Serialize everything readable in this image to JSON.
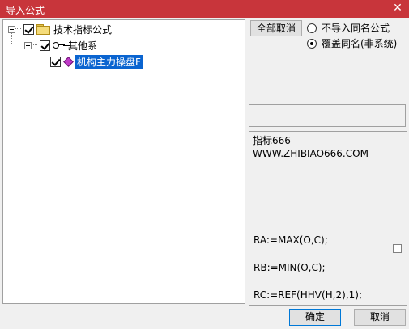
{
  "window": {
    "title": "导入公式",
    "close_glyph": "✕"
  },
  "tree": {
    "root": {
      "label": "技术指标公式",
      "checked": true
    },
    "group": {
      "label": "其他系",
      "checked": true
    },
    "item": {
      "label": "机构主力操盘F",
      "checked": true,
      "selected": true
    }
  },
  "options": {
    "deselect_all_label": "全部取消",
    "radio_skip_label": "不导入同名公式",
    "radio_overwrite_label": "覆盖同名(非系统)",
    "selected": "overwrite"
  },
  "description": {
    "line1": "指标666",
    "line2": "WWW.ZHIBIAO666.COM"
  },
  "code": {
    "lines": [
      "RA:=MAX(O,C);",
      "RB:=MIN(O,C);",
      "RC:=REF(HHV(H,2),1);"
    ]
  },
  "footer": {
    "ok_label": "确定",
    "cancel_label": "取消"
  }
}
